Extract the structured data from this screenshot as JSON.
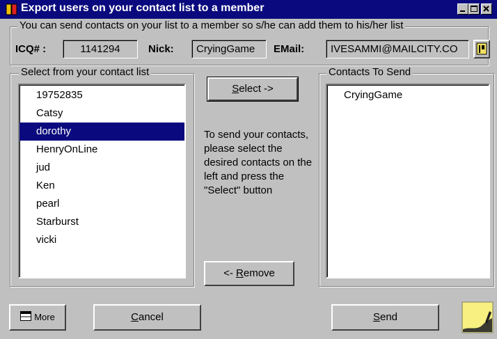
{
  "window": {
    "title": "Export users on your contact list to a member",
    "controls": [
      "minimize-icon",
      "maximize-icon",
      "close-icon"
    ]
  },
  "info_group": {
    "legend": "You can send contacts on your list to a member so s/he can add them to his/her list",
    "icq_label": "ICQ# :",
    "icq_value": "1141294",
    "nick_label": "Nick:",
    "nick_value": "CryingGame",
    "email_label": "EMail:",
    "email_value": "IVESAMMI@MAILCITY.CO"
  },
  "source_list": {
    "legend": "Select from your contact list",
    "items": [
      "19752835",
      "Catsy",
      "dorothy",
      "HenryOnLine",
      "jud",
      "Ken",
      "pearl",
      "Starburst",
      "vicki"
    ],
    "selected": "dorothy"
  },
  "select_button": {
    "label_underlined": "S",
    "label_rest": "elect ->"
  },
  "instructions": "To send your contacts, please select the desired contacts on the left and press the \"Select\" button",
  "remove_button": {
    "label_prefix": "<- ",
    "label_underlined": "R",
    "label_rest": "emove"
  },
  "target_list": {
    "legend": "Contacts To Send",
    "items": [
      "CryingGame"
    ]
  },
  "footer": {
    "more_label": "More",
    "cancel_underlined": "C",
    "cancel_rest": "ancel",
    "send_underlined": "S",
    "send_rest": "end"
  },
  "colors": {
    "titlebar": "#0a0a7e",
    "face": "#c0c0c0",
    "selection": "#0a0a7e",
    "note": "#f8f080"
  }
}
